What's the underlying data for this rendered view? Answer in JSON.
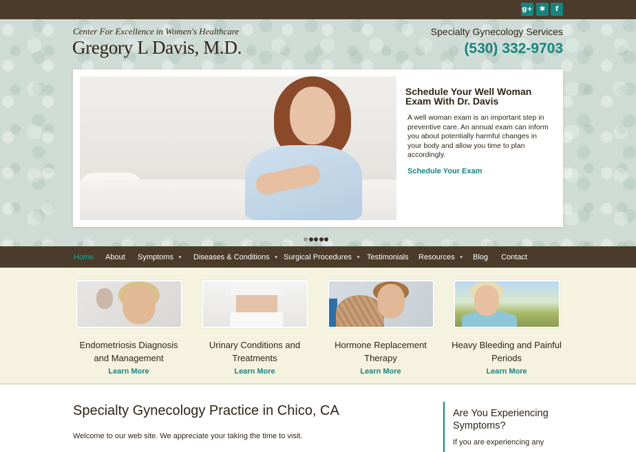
{
  "topbar": {
    "social": [
      {
        "name": "google-plus-icon",
        "glyph": "g+"
      },
      {
        "name": "yelp-icon",
        "glyph": "✱"
      },
      {
        "name": "facebook-icon",
        "glyph": "f"
      }
    ]
  },
  "header": {
    "tagline": "Center For Excellence in Women's Healthcare",
    "doctor": "Gregory L Davis, M.D.",
    "services": "Specialty Gynecology Services",
    "phone": "(530) 332-9703"
  },
  "slider": {
    "title": "Schedule Your Well Woman Exam With Dr. Davis",
    "text": "A well woman exam is an important step in preventive care. An annual exam can inform you about potentially harmful changes in your body and allow you time to plan accordingly.",
    "link": "Schedule Your Exam",
    "slide_count": 5,
    "active_slide": 2
  },
  "nav": {
    "items": [
      {
        "label": "Home",
        "active": true,
        "dropdown": false
      },
      {
        "label": "About",
        "active": false,
        "dropdown": false
      },
      {
        "label": "Symptoms",
        "active": false,
        "dropdown": true
      },
      {
        "label": "Diseases & Conditions",
        "active": false,
        "dropdown": true
      },
      {
        "label": "Surgical Procedures",
        "active": false,
        "dropdown": true
      },
      {
        "label": "Testimonials",
        "active": false,
        "dropdown": false
      },
      {
        "label": "Resources",
        "active": false,
        "dropdown": true
      },
      {
        "label": "Blog",
        "active": false,
        "dropdown": false
      },
      {
        "label": "Contact",
        "active": false,
        "dropdown": false
      }
    ],
    "caret": "▼"
  },
  "features": [
    {
      "title": "Endometriosis Diagnosis and Management",
      "link": "Learn More"
    },
    {
      "title": "Urinary Conditions and Treatments",
      "link": "Learn More"
    },
    {
      "title": "Hormone Replacement Therapy",
      "link": "Learn More"
    },
    {
      "title": "Heavy Bleeding and Painful Periods",
      "link": "Learn More"
    }
  ],
  "main": {
    "title": "Specialty Gynecology Practice in Chico, CA",
    "text": "Welcome to our web site. We appreciate your taking the time to visit."
  },
  "sidebar": {
    "title": "Are You Experiencing Symptoms?",
    "text": "If you are experiencing any"
  },
  "colors": {
    "brown": "#4a3b2a",
    "teal": "#17857f",
    "cream": "#f5f3df",
    "hero_bg": "#cfdcd6"
  }
}
